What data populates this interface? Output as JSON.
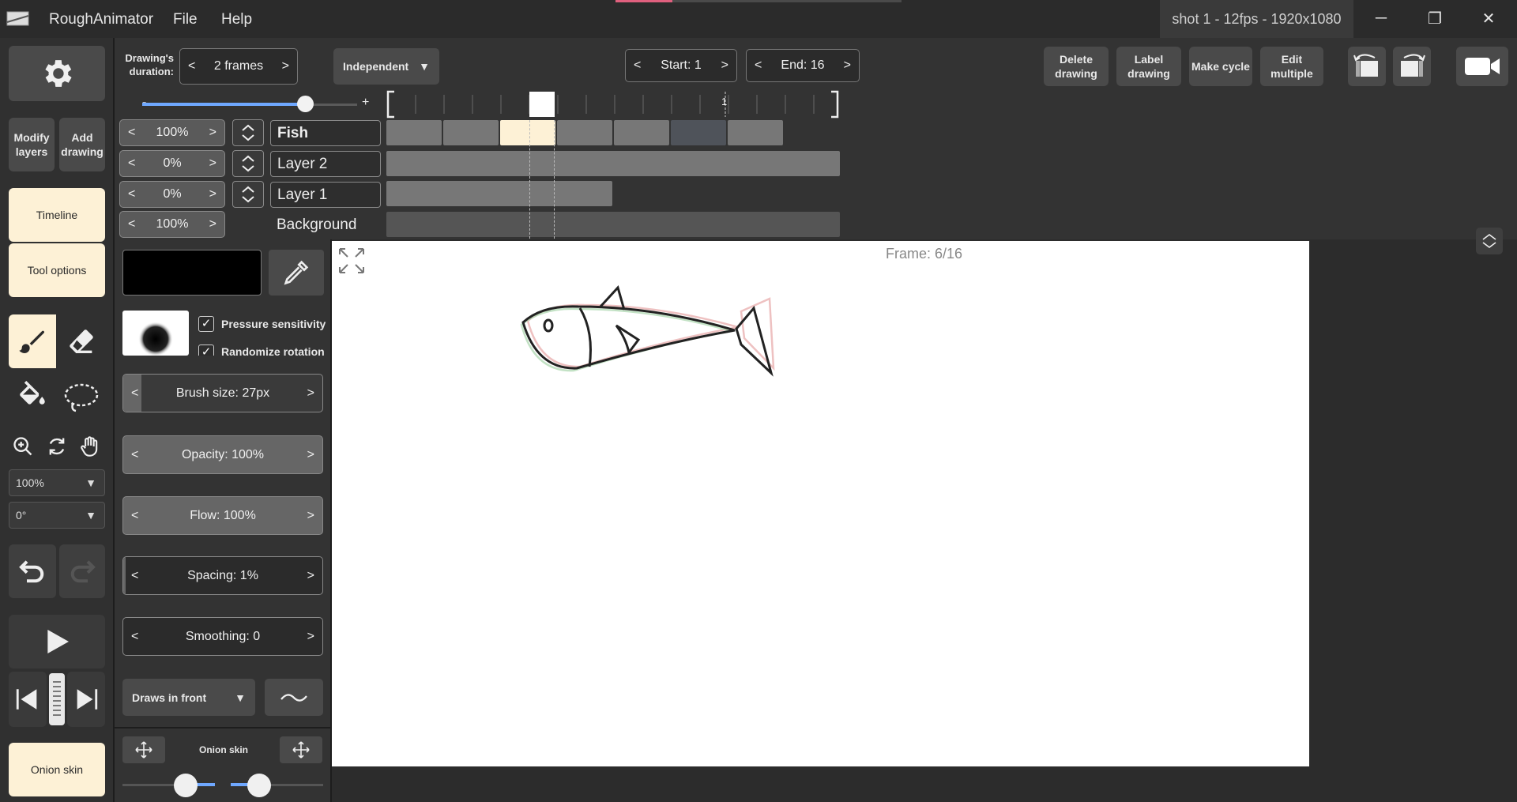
{
  "app": {
    "name": "RoughAnimator",
    "menu": [
      "File",
      "Help"
    ],
    "window_title": "shot 1 - 12fps - 1920x1080",
    "win_buttons": {
      "min": "─",
      "max": "❐",
      "close": "✕"
    }
  },
  "left": {
    "modify_layers": "Modify layers",
    "add_drawing": "Add drawing",
    "timeline": "Timeline",
    "tool_options": "Tool options",
    "zoom": "100%",
    "rotation": "0°",
    "onion_skin": "Onion skin"
  },
  "top": {
    "duration_label": "Drawing's duration:",
    "duration_value": "2 frames",
    "mode": "Independent",
    "start": "Start: 1",
    "end": "End: 16",
    "delete_drawing": "Delete drawing",
    "label_drawing": "Label drawing",
    "make_cycle": "Make cycle",
    "edit_multiple": "Edit multiple",
    "prev": "<",
    "next": ">",
    "minus": "-",
    "plus": "+",
    "marker": "1"
  },
  "layers": [
    {
      "opacity": "100%",
      "name": "Fish"
    },
    {
      "opacity": "0%",
      "name": "Layer 2"
    },
    {
      "opacity": "0%",
      "name": "Layer 1"
    },
    {
      "opacity": "100%",
      "name": "Background"
    }
  ],
  "tools": {
    "pressure": "Pressure sensitivity",
    "randomize": "Randomize rotation",
    "brush_size": "Brush size: 27px",
    "opacity": "Opacity: 100%",
    "flow": "Flow: 100%",
    "spacing": "Spacing: 1%",
    "smoothing": "Smoothing: 0",
    "draws": "Draws in front",
    "onion_skin": "Onion skin"
  },
  "canvas": {
    "frame": "Frame: 6/16"
  },
  "colors": {
    "cream": "#fdf1d6",
    "accent": "#6fa8ff",
    "pink": "#e0607e"
  }
}
